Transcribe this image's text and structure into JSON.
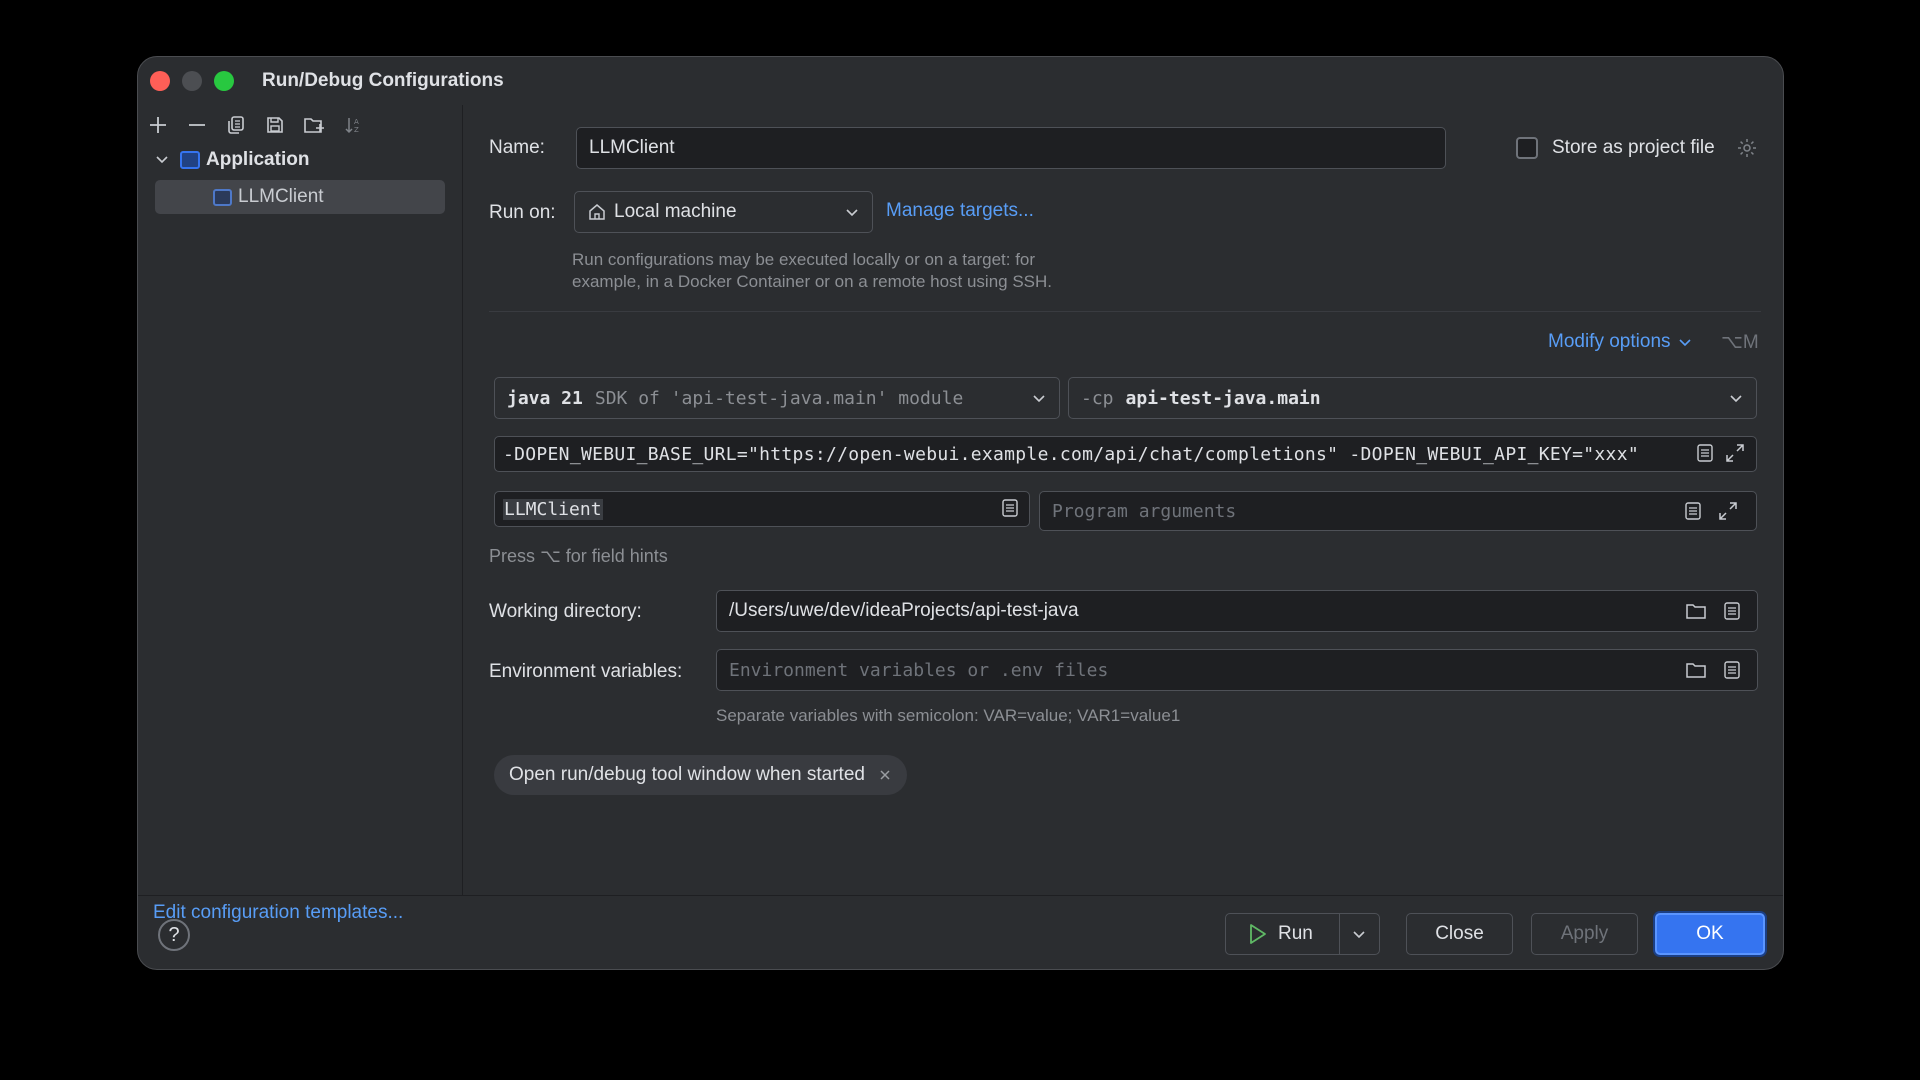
{
  "window": {
    "title": "Run/Debug Configurations"
  },
  "left_panel": {
    "toolbar_icons": [
      "add-icon",
      "remove-icon",
      "copy-icon",
      "save-icon",
      "new-folder-icon",
      "sort-icon"
    ],
    "tree": {
      "group_label": "Application",
      "items": [
        {
          "label": "LLMClient"
        }
      ]
    },
    "edit_templates_link": "Edit configuration templates..."
  },
  "form": {
    "name_label": "Name:",
    "name_value": "LLMClient",
    "store_label": "Store as project file",
    "store_checked": false,
    "run_on_label": "Run on:",
    "run_on_value": "Local machine",
    "manage_targets": "Manage targets...",
    "run_on_hint_line1": "Run configurations may be executed locally or on a target: for",
    "run_on_hint_line2": "example, in a Docker Container or on a remote host using SSH.",
    "modify_options": "Modify options",
    "modify_shortcut": "⌥M",
    "jdk_main": "java 21",
    "jdk_detail": "SDK of 'api-test-java.main' module",
    "cp_prefix": "-cp",
    "cp_value": "api-test-java.main",
    "vm_options": "-DOPEN_WEBUI_BASE_URL=\"https://open-webui.example.com/api/chat/completions\" -DOPEN_WEBUI_API_KEY=\"xxx\"",
    "main_class": "LLMClient",
    "program_args_placeholder": "Program arguments",
    "field_hints": "Press ⌥ for field hints",
    "working_dir_label": "Working directory:",
    "working_dir_value": "/Users/uwe/dev/ideaProjects/api-test-java",
    "env_label": "Environment variables:",
    "env_placeholder": "Environment variables or .env files",
    "env_hint": "Separate variables with semicolon: VAR=value; VAR1=value1",
    "chip_label": "Open run/debug tool window when started"
  },
  "buttons": {
    "help": "?",
    "run": "Run",
    "close": "Close",
    "apply": "Apply",
    "ok": "OK"
  },
  "colors": {
    "window_bg": "#2b2d30",
    "field_bg": "#1e1f22",
    "accent": "#3574f0",
    "link": "#589df6"
  }
}
